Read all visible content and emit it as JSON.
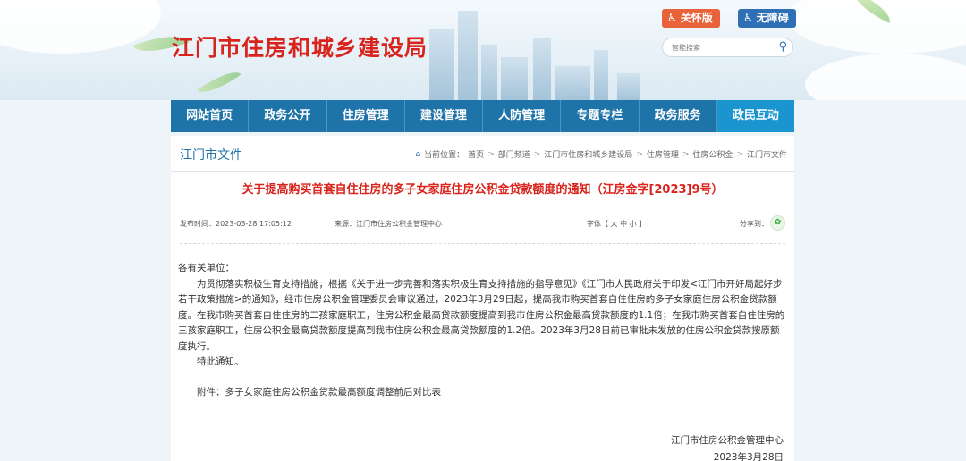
{
  "header": {
    "site_title": "江门市住房和城乡建设局",
    "care_button": "关怀版",
    "accessibility_button": "无障碍",
    "search": {
      "placeholder": "智能搜索"
    }
  },
  "nav": {
    "items": [
      {
        "label": "网站首页"
      },
      {
        "label": "政务公开"
      },
      {
        "label": "住房管理"
      },
      {
        "label": "建设管理"
      },
      {
        "label": "人防管理"
      },
      {
        "label": "专题专栏"
      },
      {
        "label": "政务服务"
      },
      {
        "label": "政民互动"
      }
    ]
  },
  "page": {
    "section_title": "江门市文件",
    "breadcrumb": {
      "prefix": "当前位置：",
      "items": [
        "首页",
        "部门频道",
        "江门市住房和城乡建设局",
        "住房管理",
        "住房公积金",
        "江门市文件"
      ]
    },
    "article": {
      "title": "关于提高购买首套自住住房的多子女家庭住房公积金贷款额度的通知（江房金字[2023]9号）",
      "publish_time": "发布时间：2023-03-28 17:05:12",
      "source": "来源：江门市住房公积金管理中心",
      "font_size_label": "字体【 大  中  小 】",
      "share_label": "分享到：",
      "salutation": "各有关单位：",
      "paragraph": "为贯彻落实积极生育支持措施，根据《关于进一步完善和落实积极生育支持措施的指导意见》《江门市人民政府关于印发<江门市开好局起好步若干政策措施>的通知》，经市住房公积金管理委员会审议通过，2023年3月29日起，提高我市购买首套自住住房的多子女家庭住房公积金贷款额度。在我市购买首套自住住房的二孩家庭职工，住房公积金最高贷款额度提高到我市住房公积金最高贷款额度的1.1倍；在我市购买首套自住住房的三孩家庭职工，住房公积金最高贷款额度提高到我市住房公积金最高贷款额度的1.2倍。2023年3月28日前已审批未发放的住房公积金贷款按原额度执行。",
      "closing": "特此通知。",
      "attachment": "附件：多子女家庭住房公积金贷款最高额度调整前后对比表",
      "sign_org": "江门市住房公积金管理中心",
      "sign_date": "2023年3月28日"
    }
  },
  "colors": {
    "title_red": "#d8241c",
    "nav_blue": "#1e73a8",
    "nav_active": "#1a95cf"
  }
}
